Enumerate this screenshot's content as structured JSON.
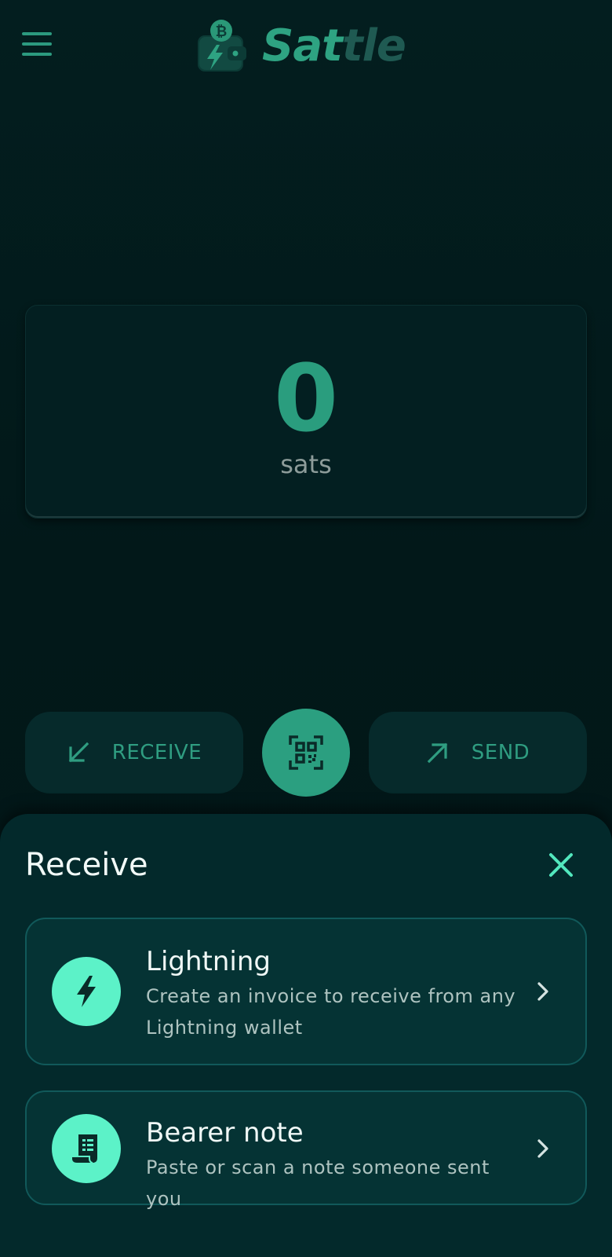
{
  "header": {
    "brand_part1": "Sat",
    "brand_part2": "tle",
    "menu_icon": "hamburger-menu-icon",
    "logo_icon": "wallet-bitcoin-lightning-icon"
  },
  "balance": {
    "amount": "0",
    "unit": "sats"
  },
  "actions": {
    "receive_label": "RECEIVE",
    "send_label": "SEND",
    "receive_icon": "arrow-down-left-icon",
    "send_icon": "arrow-up-right-icon",
    "scan_icon": "qr-code-scan-icon"
  },
  "sheet": {
    "title": "Receive",
    "close_icon": "close-icon",
    "options": [
      {
        "title": "Lightning",
        "description": "Create an invoice to receive from any Lightning wallet",
        "icon": "lightning-bolt-icon"
      },
      {
        "title": "Bearer note",
        "description": "Paste or scan a note someone sent you",
        "icon": "receipt-note-icon"
      }
    ]
  },
  "colors": {
    "background": "#021a1c",
    "accent": "#2b9f80",
    "accent_bright": "#5cf2c8",
    "sheet": "#03292b",
    "muted_text": "#8d9c9a"
  }
}
